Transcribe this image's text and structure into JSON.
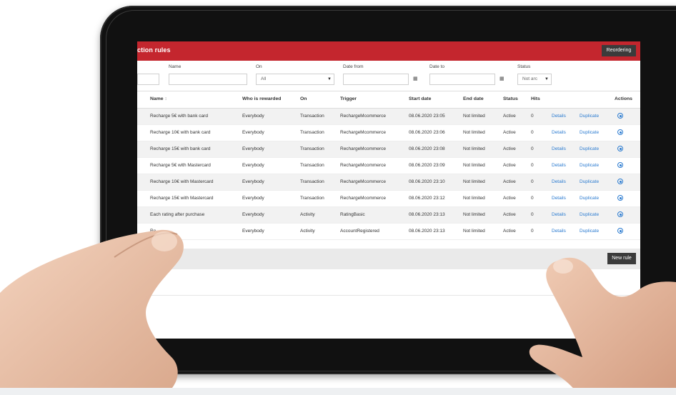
{
  "header": {
    "title": "ction rules",
    "reordering_label": "Reordering"
  },
  "filters": {
    "name_label": "Name",
    "on_label": "On",
    "on_value": "All",
    "date_from_label": "Date from",
    "date_to_label": "Date to",
    "status_label": "Status",
    "status_value": "Not arc"
  },
  "table": {
    "headers": {
      "name": "Name",
      "sort_arrow": "↕",
      "who": "Who is rewarded",
      "on": "On",
      "trigger": "Trigger",
      "start": "Start date",
      "end": "End date",
      "status": "Status",
      "hits": "Hits",
      "actions": "Actions"
    },
    "rows": [
      {
        "name": "Recharge 5€ with bank card",
        "who": "Everybody",
        "on": "Transaction",
        "trigger": "RechargeMcommerce",
        "start": "08.06.2020 23:05",
        "end": "Not limited",
        "status": "Active",
        "hits": "0",
        "details": "Details",
        "duplicate": "Duplicate"
      },
      {
        "name": "Recharge 10€ with bank card",
        "who": "Everybody",
        "on": "Transaction",
        "trigger": "RechargeMcommerce",
        "start": "08.06.2020 23:06",
        "end": "Not limited",
        "status": "Active",
        "hits": "0",
        "details": "Details",
        "duplicate": "Duplicate"
      },
      {
        "name": "Recharge 15€ with bank card",
        "who": "Everybody",
        "on": "Transaction",
        "trigger": "RechargeMcommerce",
        "start": "08.06.2020 23:08",
        "end": "Not limited",
        "status": "Active",
        "hits": "0",
        "details": "Details",
        "duplicate": "Duplicate"
      },
      {
        "name": "Recharge 5€ with Mastercard",
        "who": "Everybody",
        "on": "Transaction",
        "trigger": "RechargeMcommerce",
        "start": "08.06.2020 23:09",
        "end": "Not limited",
        "status": "Active",
        "hits": "0",
        "details": "Details",
        "duplicate": "Duplicate"
      },
      {
        "name": "Recharge 10€ with Mastercard",
        "who": "Everybody",
        "on": "Transaction",
        "trigger": "RechargeMcommerce",
        "start": "08.06.2020 23:10",
        "end": "Not limited",
        "status": "Active",
        "hits": "0",
        "details": "Details",
        "duplicate": "Duplicate"
      },
      {
        "name": "Recharge 15€ with Mastercard",
        "who": "Everybody",
        "on": "Transaction",
        "trigger": "RechargeMcommerce",
        "start": "08.06.2020 23:12",
        "end": "Not limited",
        "status": "Active",
        "hits": "0",
        "details": "Details",
        "duplicate": "Duplicate"
      },
      {
        "name": "Each rating after purchase",
        "who": "Everybody",
        "on": "Activity",
        "trigger": "RatingBasic",
        "start": "08.06.2020 23:13",
        "end": "Not limited",
        "status": "Active",
        "hits": "0",
        "details": "Details",
        "duplicate": "Duplicate"
      },
      {
        "name": "Re",
        "who": "Everybody",
        "on": "Activity",
        "trigger": "AccountRegistered",
        "start": "08.06.2020 23:13",
        "end": "Not limited",
        "status": "Active",
        "hits": "0",
        "details": "Details",
        "duplicate": "Duplicate"
      }
    ]
  },
  "footer": {
    "new_rule_label": "New rule"
  },
  "icons": {
    "calendar": "calendar-icon",
    "action": "view-icon",
    "select_arrow": "chevron-down-icon"
  },
  "colors": {
    "accent": "#c4262e",
    "link": "#2b7bd0",
    "dark_button": "#3b3b3b"
  }
}
